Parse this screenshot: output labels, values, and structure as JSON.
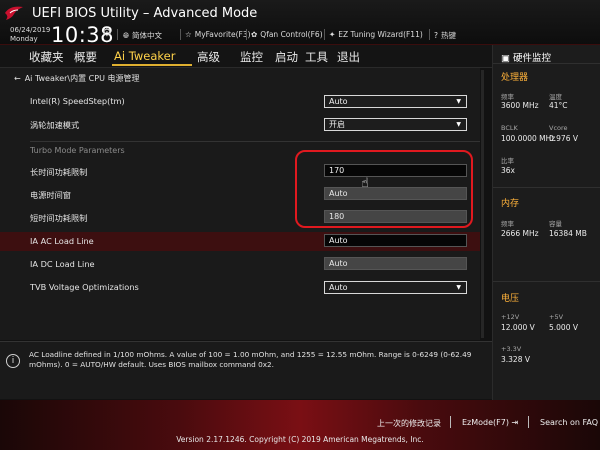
{
  "header": {
    "title": "UEFI BIOS Utility – Advanced Mode",
    "date": "06/24/2019",
    "weekday": "Monday",
    "time": "10:38",
    "tools": [
      {
        "icon": "globe-icon",
        "label": "简体中文"
      },
      {
        "icon": "star-icon",
        "label": "MyFavorite(F3)"
      },
      {
        "icon": "fan-icon",
        "label": "Qfan Control(F6)"
      },
      {
        "icon": "wand-icon",
        "label": "EZ Tuning Wizard(F11)"
      },
      {
        "icon": "question-icon",
        "label": "热键"
      }
    ]
  },
  "menu": {
    "tabs": [
      "收藏夹",
      "概要",
      "Ai Tweaker",
      "高级",
      "监控",
      "启动",
      "工具",
      "退出"
    ],
    "active": "Ai Tweaker"
  },
  "breadcrumb": "Ai Tweaker\\内置 CPU 电源管理",
  "settings": {
    "speedstep": {
      "label": "Intel(R) SpeedStep(tm)",
      "value": "Auto"
    },
    "turbo_mode": {
      "label": "涡轮加速模式",
      "value": "开启"
    },
    "turbo_params_title": "Turbo Mode Parameters",
    "long_power_limit": {
      "label": "长时间功耗限制",
      "value": "170"
    },
    "power_window": {
      "label": "电源时间窗",
      "value": "Auto"
    },
    "short_power_limit": {
      "label": "短时间功耗限制",
      "value": "180"
    },
    "ia_ac_loadline": {
      "label": "IA AC Load Line",
      "value": "Auto"
    },
    "ia_dc_loadline": {
      "label": "IA DC Load Line",
      "value": "Auto"
    },
    "tvb_voltage": {
      "label": "TVB Voltage Optimizations",
      "value": "Auto"
    }
  },
  "help": {
    "text": "AC Loadline defined in 1/100 mOhms. A value of 100 = 1.00 mOhm, and 1255 = 12.55 mOhm. Range is 0-6249 (0-62.49 mOhms). 0 = AUTO/HW default. Uses BIOS mailbox command 0x2."
  },
  "monitor": {
    "title": "硬件监控",
    "cpu": {
      "title": "处理器",
      "freq_label": "频率",
      "freq_value": "3600 MHz",
      "temp_label": "温度",
      "temp_value": "41°C",
      "bclk_label": "BCLK",
      "bclk_value": "100.0000 MHz",
      "vcore_label": "Vcore",
      "vcore_value": "0.976 V",
      "ratio_label": "比率",
      "ratio_value": "36x"
    },
    "memory": {
      "title": "内存",
      "freq_label": "频率",
      "freq_value": "2666 MHz",
      "cap_label": "容量",
      "cap_value": "16384 MB"
    },
    "voltage": {
      "title": "电压",
      "v12_label": "+12V",
      "v12_value": "12.000 V",
      "v5_label": "+5V",
      "v5_value": "5.000 V",
      "v33_label": "+3.3V",
      "v33_value": "3.328 V"
    }
  },
  "footer": {
    "last_modified": "上一次的修改记录",
    "ezmode": "EzMode(F7)",
    "search": "Search on FAQ",
    "version": "Version 2.17.1246. Copyright (C) 2019 American Megatrends, Inc."
  }
}
